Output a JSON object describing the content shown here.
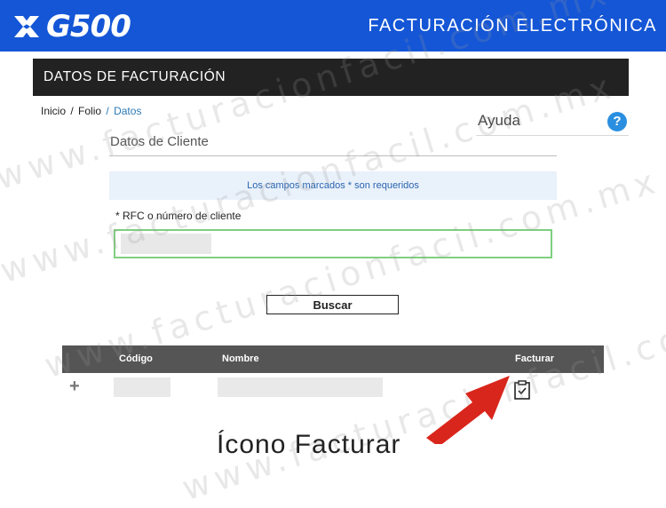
{
  "header": {
    "logo_text": "G500",
    "title": "FACTURACIÓN ELECTRÓNICA",
    "brand_color": "#1456d6"
  },
  "section": {
    "title": "DATOS DE FACTURACIÓN"
  },
  "breadcrumb": {
    "items": [
      "Inicio",
      "Folio",
      "Datos"
    ],
    "separator": "/"
  },
  "help": {
    "label": "Ayuda",
    "icon": "question-icon",
    "icon_glyph": "?"
  },
  "panel": {
    "title": "Datos de Cliente"
  },
  "notice": {
    "text": "Los campos marcados * son requeridos"
  },
  "form": {
    "rfc_label": "* RFC o número de cliente",
    "rfc_value": ""
  },
  "buttons": {
    "search": "Buscar"
  },
  "table": {
    "columns": [
      "Código",
      "Nombre",
      "Facturar"
    ],
    "row_icon": "clipboard-check-icon",
    "expand_glyph": "+"
  },
  "watermark": {
    "text": "www.facturacionfacil.com.mx"
  },
  "annotation": {
    "caption": "Ícono Facturar",
    "arrow_color": "#d9261c"
  }
}
